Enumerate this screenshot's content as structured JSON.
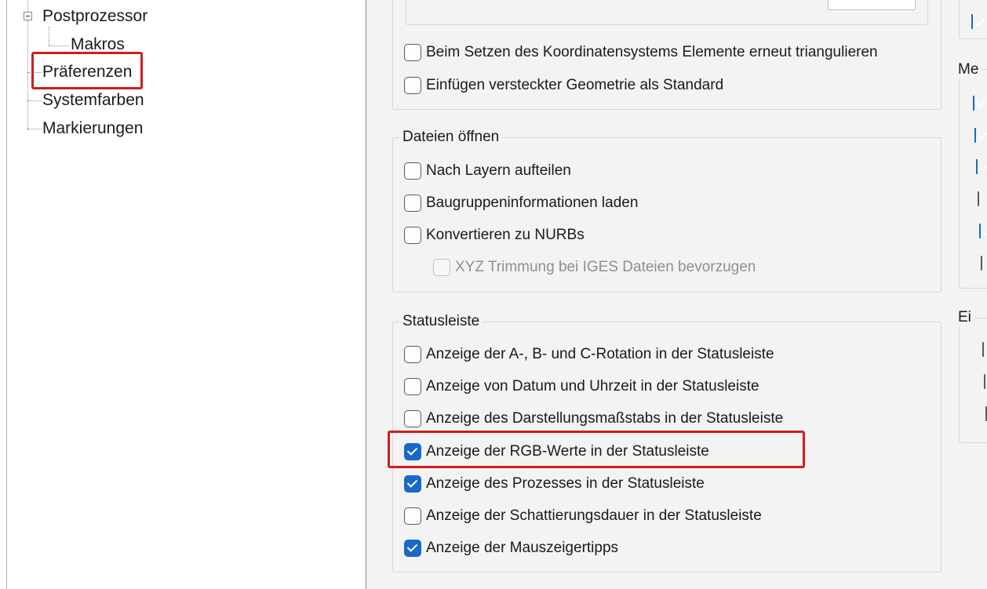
{
  "tree": {
    "items": [
      {
        "label": "Postprozessor"
      },
      {
        "label": "Makros"
      },
      {
        "label": "Präferenzen"
      },
      {
        "label": "Systemfarben"
      },
      {
        "label": "Markierungen"
      }
    ]
  },
  "general_options": {
    "items": [
      {
        "label": "Beim Setzen des Koordinatensystems Elemente erneut triangulieren",
        "checked": false
      },
      {
        "label": "Einfügen versteckter Geometrie als Standard",
        "checked": false
      }
    ]
  },
  "files_open": {
    "title": "Dateien öffnen",
    "items": [
      {
        "label": "Nach Layern aufteilen",
        "checked": false
      },
      {
        "label": "Baugruppeninformationen laden",
        "checked": false
      },
      {
        "label": "Konvertieren zu NURBs",
        "checked": false
      },
      {
        "label": "XYZ Trimmung bei IGES Dateien bevorzugen",
        "checked": false,
        "disabled": true
      }
    ]
  },
  "statusbar": {
    "title": "Statusleiste",
    "items": [
      {
        "label": "Anzeige der A-, B- und C-Rotation in der Statusleiste",
        "checked": false
      },
      {
        "label": "Anzeige von Datum und Uhrzeit in der Statusleiste",
        "checked": false
      },
      {
        "label": "Anzeige des Darstellungsmaßstabs in der Statusleiste",
        "checked": false
      },
      {
        "label": "Anzeige der RGB-Werte in der Statusleiste",
        "checked": true
      },
      {
        "label": "Anzeige des Prozesses in der Statusleiste",
        "checked": true
      },
      {
        "label": "Anzeige der Schattierungsdauer in der Statusleiste",
        "checked": false
      },
      {
        "label": "Anzeige der Mauszeigertipps",
        "checked": true
      }
    ]
  },
  "right_groups": {
    "top_checked": true,
    "group1_title": "Me",
    "group1_checks": [
      true,
      true,
      true,
      false,
      true,
      false
    ],
    "group2_title": "Ei",
    "group2_checks": [
      false,
      false,
      false
    ]
  },
  "colors": {
    "accent": "#1a68c9",
    "highlight": "#d01d1d"
  }
}
